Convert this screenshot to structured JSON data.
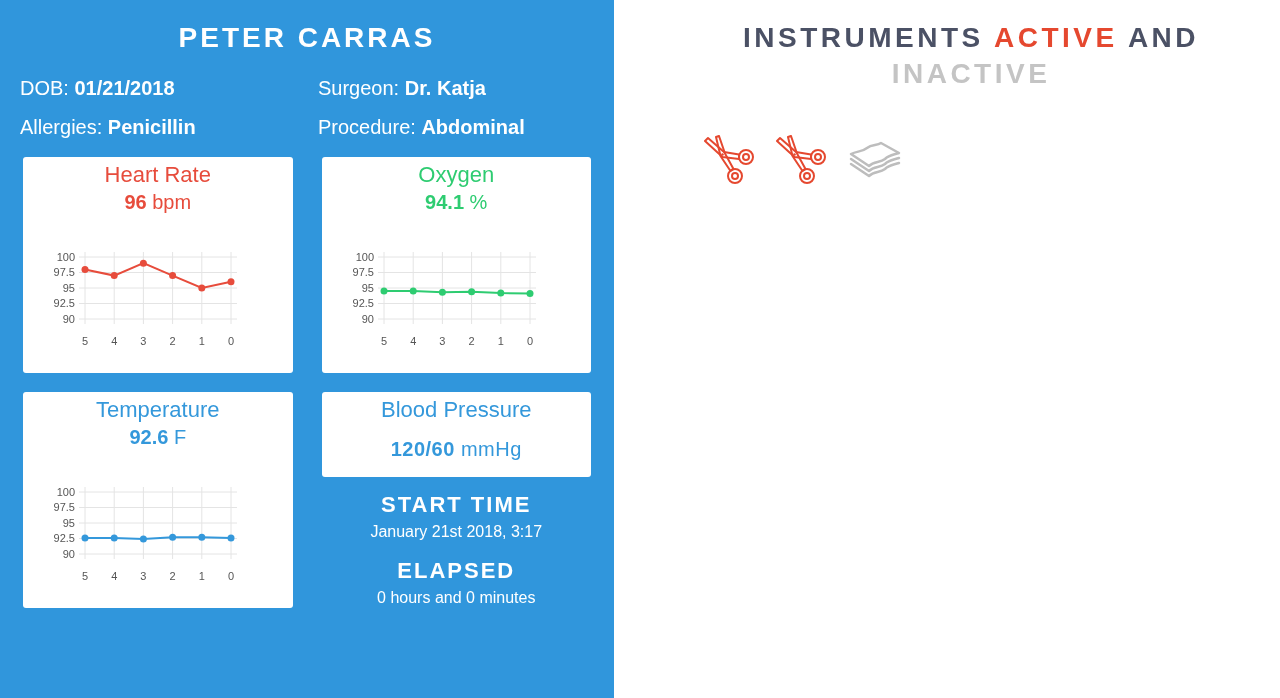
{
  "patient": {
    "name": "PETER CARRAS",
    "details": [
      "DOB: **01/21/2018**",
      "Surgeon: **Dr. Katja**",
      "Allergies: **Penicillin**",
      "Procedure: **Abdominal**"
    ]
  },
  "vitals": [
    {
      "title": "Heart Rate",
      "reading": "**96** bpm",
      "color": "#e74c3c",
      "chart_data": {
        "type": "line",
        "categories": [
          "5",
          "4",
          "3",
          "2",
          "1",
          "0"
        ],
        "values": [
          98,
          97,
          99,
          97,
          95,
          96
        ],
        "color": "#e74c3c",
        "yticks": [
          90,
          92.5,
          95,
          97.5,
          100
        ],
        "ylim": [
          90,
          100
        ],
        "grid": true,
        "marker": "circle"
      }
    },
    {
      "title": "Oxygen",
      "reading": "**94.1** %",
      "color": "#2ecc71",
      "chart_data": {
        "type": "line",
        "categories": [
          "5",
          "4",
          "3",
          "2",
          "1",
          "0"
        ],
        "values": [
          94.5,
          94.5,
          94.3,
          94.4,
          94.2,
          94.1
        ],
        "color": "#2ecc71",
        "yticks": [
          90,
          92.5,
          95,
          97.5,
          100
        ],
        "ylim": [
          90,
          100
        ],
        "grid": true,
        "marker": "circle"
      }
    },
    {
      "title": "Temperature",
      "reading": "**92.6** F",
      "color": "#3498db",
      "chart_data": {
        "type": "line",
        "categories": [
          "5",
          "4",
          "3",
          "2",
          "1",
          "0"
        ],
        "values": [
          92.6,
          92.6,
          92.4,
          92.7,
          92.7,
          92.6
        ],
        "color": "#3498db",
        "yticks": [
          90,
          92.5,
          95,
          97.5,
          100
        ],
        "ylim": [
          90,
          100
        ],
        "grid": true,
        "marker": "circle"
      }
    },
    {
      "title": "Blood Pressure",
      "reading": "**120/60** mmHg",
      "color": "#3498db"
    }
  ],
  "timing": [
    {
      "label": "START TIME",
      "value": "January 21st 2018, 3:17"
    },
    {
      "label": "ELAPSED",
      "value": "0 hours and 0 minutes"
    }
  ],
  "instruments_panel": {
    "heading": [
      {
        "text": "INSTRUMENTS",
        "kind": "plain"
      },
      {
        "text": "ACTIVE",
        "kind": "active"
      },
      {
        "text": "AND",
        "kind": "plain"
      },
      {
        "text": "INACTIVE",
        "kind": "inactive"
      }
    ],
    "instruments": [
      {
        "kind": "scissors",
        "active": true
      },
      {
        "kind": "scissors",
        "active": true
      },
      {
        "kind": "gauze",
        "active": false
      }
    ]
  }
}
